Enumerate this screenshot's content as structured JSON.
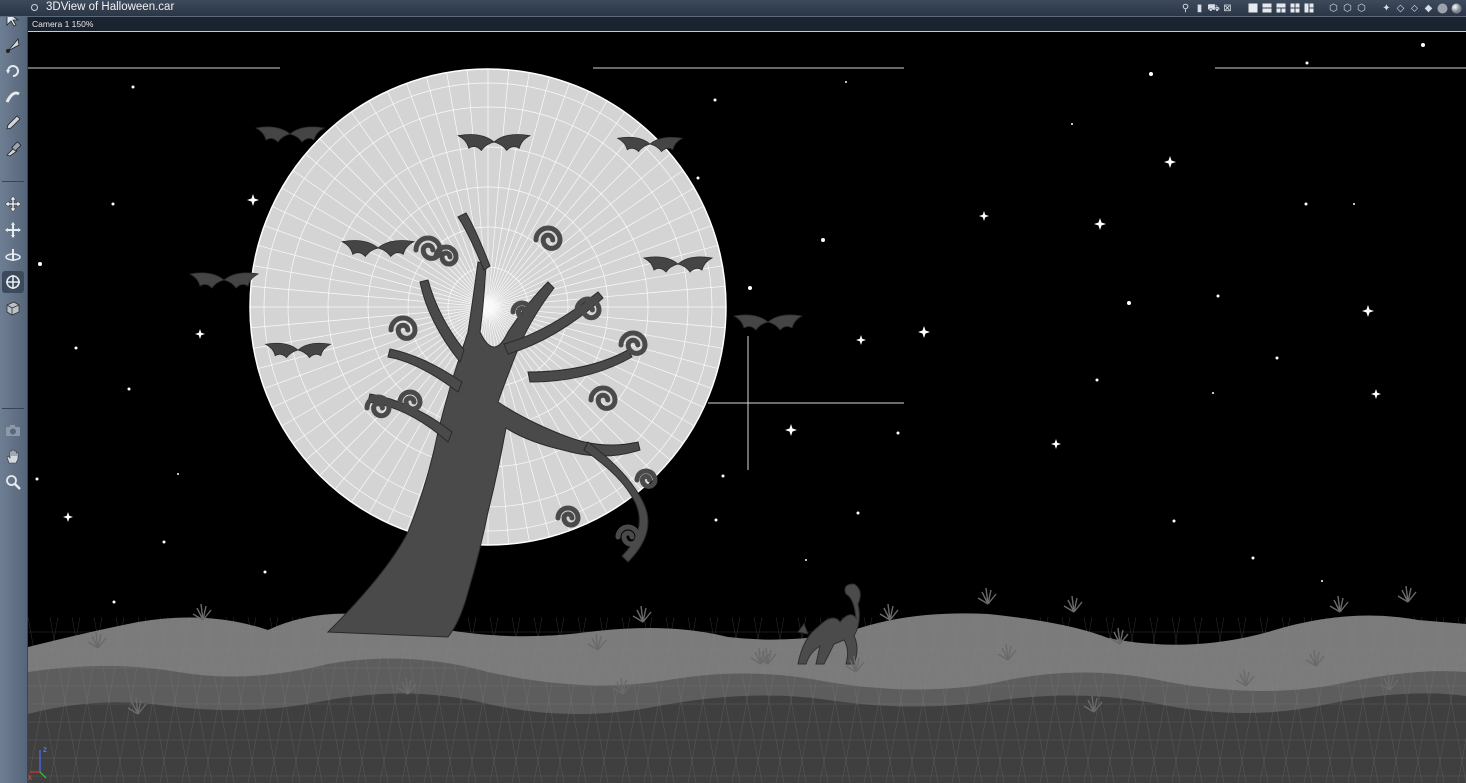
{
  "window": {
    "title": "3DView of Halloween.car",
    "camera_label": "Camera 1 150%"
  },
  "left_toolbar": {
    "tools": [
      {
        "icon": "arrow-select-icon"
      },
      {
        "icon": "node-select-icon"
      },
      {
        "icon": "rotate-icon"
      },
      {
        "icon": "bend-icon"
      },
      {
        "icon": "pencil-icon"
      },
      {
        "icon": "paint-icon"
      },
      {
        "icon": "move-icon"
      },
      {
        "icon": "move-xy-icon"
      },
      {
        "icon": "move-z-icon"
      },
      {
        "icon": "orbit-icon"
      },
      {
        "icon": "render-cube-icon"
      },
      {
        "icon": "camera-icon"
      },
      {
        "icon": "hand-pan-icon"
      },
      {
        "icon": "zoom-icon"
      }
    ]
  },
  "right_toolbar": {
    "icons": [
      "link-icon",
      "lock-icon",
      "car-icon",
      "target-icon",
      "layout-single-icon",
      "layout-two-icon",
      "layout-three-icon",
      "layout-four-icon",
      "layout-grid-icon",
      "shield-view-icon",
      "shield-view-2-icon",
      "shield-view-3-icon",
      "compass-icon",
      "cube-outline-icon",
      "wire-cube-icon",
      "shaded-cube-icon",
      "sphere-icon",
      "lit-sphere-icon"
    ]
  },
  "scene": {
    "colors": {
      "background": "#000000",
      "moon": "#d7d7d7",
      "mesh": "#ffffff",
      "tree": "#4a4a4a",
      "hill_back": "#7a7a7a",
      "hill_mid": "#5c5c5c",
      "hill_front": "#3e3e3e",
      "bat": "#444444",
      "star": "#ffffff"
    },
    "objects": [
      "moon",
      "tree",
      "bats",
      "cat",
      "stars",
      "hills",
      "grass"
    ],
    "axis_labels": {
      "z": "z",
      "x": "x"
    }
  }
}
